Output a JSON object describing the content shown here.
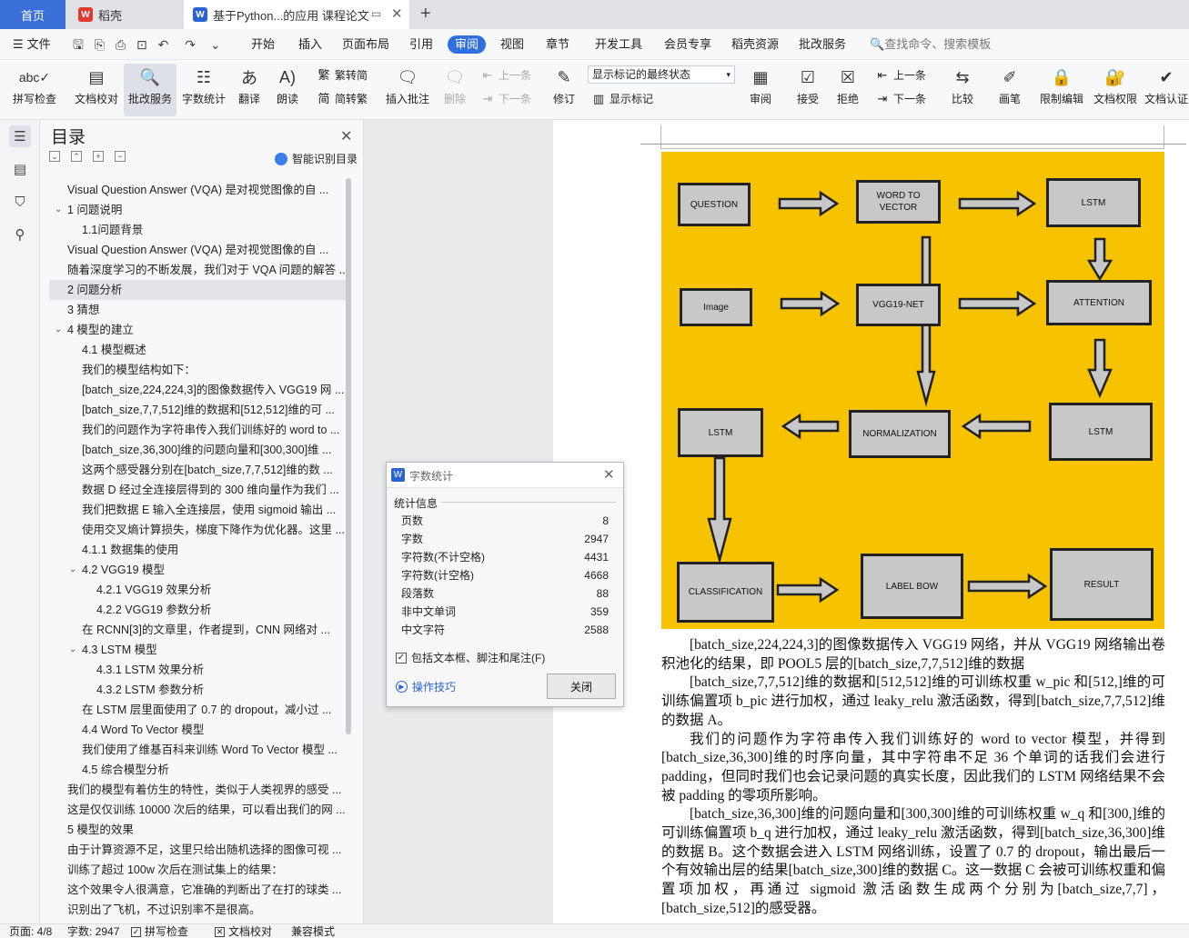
{
  "tabs": {
    "home": "首页",
    "daoke": "稻壳",
    "doc": "基于Python...的应用 课程论文",
    "new_tab": "+"
  },
  "menu": {
    "file": "文件",
    "items": [
      "开始",
      "插入",
      "页面布局",
      "引用",
      "审阅",
      "视图",
      "章节",
      "开发工具",
      "会员专享",
      "稻壳资源",
      "批改服务"
    ],
    "active": "审阅",
    "search": "查找命令、搜索模板"
  },
  "toolbar": {
    "spell": "拼写检查",
    "doc_check": "文档校对",
    "correct": "批改服务",
    "word_count": "字数统计",
    "translate": "翻译",
    "read": "朗读",
    "trad": "繁转简",
    "simp": "简转繁",
    "insert_comment": "插入批注",
    "delete": "删除",
    "prev": "上一条",
    "next": "下一条",
    "revise": "修订",
    "markup_state": "显示标记的最终状态",
    "show_markup": "显示标记",
    "review": "审阅",
    "accept": "接受",
    "reject": "拒绝",
    "prev2": "上一条",
    "next2": "下一条",
    "compare": "比较",
    "pen": "画笔",
    "restrict": "限制编辑",
    "permission": "文档权限",
    "certify": "文档认证"
  },
  "toc": {
    "title": "目录",
    "smart": "智能识别目录",
    "items": [
      {
        "text": "Visual Question Answer (VQA) 是对视觉图像的自 ...",
        "indent": 1,
        "chev": ""
      },
      {
        "text": "1  问题说明",
        "indent": 1,
        "chev": "v"
      },
      {
        "text": "1.1问题背景",
        "indent": 2,
        "chev": ""
      },
      {
        "text": "Visual Question Answer (VQA) 是对视觉图像的自 ...",
        "indent": 1,
        "chev": ""
      },
      {
        "text": "随着深度学习的不断发展，我们对于 VQA 问题的解答 ...",
        "indent": 1,
        "chev": ""
      },
      {
        "text": "2  问题分析",
        "indent": 1,
        "chev": "",
        "selected": true
      },
      {
        "text": "3  猜想",
        "indent": 1,
        "chev": ""
      },
      {
        "text": "4  模型的建立",
        "indent": 1,
        "chev": "v"
      },
      {
        "text": "4.1  模型概述",
        "indent": 2,
        "chev": ""
      },
      {
        "text": " 我们的模型结构如下：",
        "indent": 2,
        "chev": ""
      },
      {
        "text": "[batch_size,224,224,3]的图像数据传入 VGG19 网 ...",
        "indent": 2,
        "chev": ""
      },
      {
        "text": "[batch_size,7,7,512]维的数据和[512,512]维的可 ...",
        "indent": 2,
        "chev": ""
      },
      {
        "text": "我们的问题作为字符串传入我们训练好的 word to ...",
        "indent": 2,
        "chev": ""
      },
      {
        "text": "[batch_size,36,300]维的问题向量和[300,300]维 ...",
        "indent": 2,
        "chev": ""
      },
      {
        "text": "这两个感受器分别在[batch_size,7,7,512]维的数 ...",
        "indent": 2,
        "chev": ""
      },
      {
        "text": "数据 D 经过全连接层得到的 300 维向量作为我们 ...",
        "indent": 2,
        "chev": ""
      },
      {
        "text": "我们把数据 E 输入全连接层，使用 sigmoid 输出 ...",
        "indent": 2,
        "chev": ""
      },
      {
        "text": "使用交叉熵计算损失，梯度下降作为优化器。这里 ...",
        "indent": 2,
        "chev": ""
      },
      {
        "text": "4.1.1  数据集的使用",
        "indent": 2,
        "chev": ""
      },
      {
        "text": "4.2 VGG19 模型",
        "indent": 2,
        "chev": "v"
      },
      {
        "text": "4.2.1 VGG19  效果分析",
        "indent": 3,
        "chev": ""
      },
      {
        "text": "4.2.2 VGG19  参数分析",
        "indent": 3,
        "chev": ""
      },
      {
        "text": " 在 RCNN[3]的文章里，作者提到，CNN 网络对 ...",
        "indent": 2,
        "chev": ""
      },
      {
        "text": "4.3 LSTM 模型",
        "indent": 2,
        "chev": "v"
      },
      {
        "text": "4.3.1 LSTM  效果分析",
        "indent": 3,
        "chev": ""
      },
      {
        "text": "4.3.2 LSTM  参数分析",
        "indent": 3,
        "chev": ""
      },
      {
        "text": " 在 LSTM 层里面使用了 0.7 的 dropout，减小过 ...",
        "indent": 2,
        "chev": ""
      },
      {
        "text": "4.4 Word To Vector 模型",
        "indent": 2,
        "chev": ""
      },
      {
        "text": " 我们使用了维基百科来训练 Word To Vector 模型 ...",
        "indent": 2,
        "chev": ""
      },
      {
        "text": "4.5  综合模型分析",
        "indent": 2,
        "chev": ""
      },
      {
        "text": "我们的模型有着仿生的特性，类似于人类视界的感受 ...",
        "indent": 1,
        "chev": ""
      },
      {
        "text": "这是仅仅训练 10000 次后的结果，可以看出我们的网 ...",
        "indent": 1,
        "chev": ""
      },
      {
        "text": "5  模型的效果",
        "indent": 1,
        "chev": ""
      },
      {
        "text": "由于计算资源不足，这里只给出随机选择的图像可视 ...",
        "indent": 1,
        "chev": ""
      },
      {
        "text": "训练了超过 100w 次后在测试集上的结果：",
        "indent": 1,
        "chev": ""
      },
      {
        "text": "这个效果令人很满意，它准确的判断出了在打的球类 ...",
        "indent": 1,
        "chev": ""
      },
      {
        "text": "识别出了飞机，不过识别率不是很高。",
        "indent": 1,
        "chev": ""
      }
    ]
  },
  "diagram": {
    "question": "QUESTION",
    "w2v": "WORD TO\nVECTOR",
    "lstm1": "LSTM",
    "image": "Image",
    "vgg": "VGG19-NET",
    "attention": "ATTENTION",
    "lstm2": "LSTM",
    "norm": "NORMALIZATION",
    "lstm3": "LSTM",
    "classification": "CLASSIFICATION",
    "labelbow": "LABEL BOW",
    "result": "RESULT"
  },
  "doc": {
    "paragraphs": [
      "[batch_size,224,224,3]的图像数据传入 VGG19 网络，并从 VGG19 网络输出卷积池化的结果，即 POOL5 层的[batch_size,7,7,512]维的数据",
      "[batch_size,7,7,512]维的数据和[512,512]维的可训练权重 w_pic 和[512,]维的可训练偏置项 b_pic 进行加权，通过 leaky_relu 激活函数，得到[batch_size,7,7,512]维的数据 A。",
      "我们的问题作为字符串传入我们训练好的 word to vector 模型，并得到[batch_size,36,300]维的时序向量，其中字符串不足 36 个单词的话我们会进行 padding，但同时我们也会记录问题的真实长度，因此我们的 LSTM 网络结果不会被 padding 的零项所影响。",
      "[batch_size,36,300]维的问题向量和[300,300]维的可训练权重 w_q 和[300,]维的可训练偏置项 b_q 进行加权，通过 leaky_relu 激活函数，得到[batch_size,36,300]维的数据 B。这个数据会进入 LSTM 网络训练，设置了 0.7 的 dropout，输出最后一个有效输出层的结果[batch_size,300]维的数据 C。这一数据 C 会被可训练权重和偏置项加权，再通过 sigmoid 激活函数生成两个分别为[batch_size,7,7]，[batch_size,512]的感受器。"
    ]
  },
  "dialog": {
    "title": "字数统计",
    "section": "统计信息",
    "rows": [
      {
        "label": "页数",
        "value": "8"
      },
      {
        "label": "字数",
        "value": "2947"
      },
      {
        "label": "字符数(不计空格)",
        "value": "4431"
      },
      {
        "label": "字符数(计空格)",
        "value": "4668"
      },
      {
        "label": "段落数",
        "value": "88"
      },
      {
        "label": "非中文单词",
        "value": "359"
      },
      {
        "label": "中文字符",
        "value": "2588"
      }
    ],
    "checkbox": "包括文本框、脚注和尾注(F)",
    "tip": "操作技巧",
    "close": "关闭"
  },
  "status": {
    "page": "页面: 4/8",
    "words": "字数: 2947",
    "spell": "拼写检查",
    "doc_check": "文档校对",
    "compat": "兼容模式"
  },
  "colors": {
    "accent": "#2f6fe0",
    "diagram_bg": "#f7c300",
    "node_fill": "#c8c8c8"
  }
}
